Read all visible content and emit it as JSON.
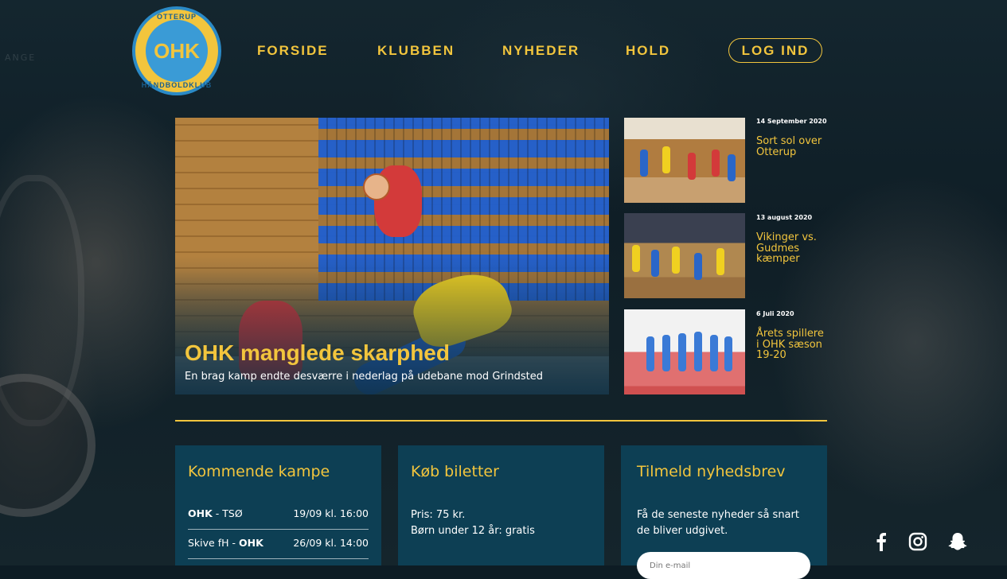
{
  "logo": {
    "ring_top": "OTTERUP",
    "center": "OHK",
    "ring_bottom": "HÅNDBOLDKLUB"
  },
  "background": {
    "banner_fragment": "ANGE"
  },
  "nav": {
    "items": [
      {
        "label": "FORSIDE"
      },
      {
        "label": "KLUBBEN"
      },
      {
        "label": "NYHEDER"
      },
      {
        "label": "HOLD"
      }
    ],
    "login_label": "LOG IND"
  },
  "hero": {
    "title": "OHK manglede skarphed",
    "subtitle": "En brag kamp endte desværre i nederlag på udebane mod Grindsted"
  },
  "news": [
    {
      "date": "14 September 2020",
      "title": "Sort sol over Otterup"
    },
    {
      "date": "13 august 2020",
      "title": "Vikinger vs. Gudmes kæmper"
    },
    {
      "date": "6 Juli 2020",
      "title": "Årets spillere i OHK sæson 19-20"
    }
  ],
  "matches": {
    "title": "Kommende kampe",
    "rows": [
      {
        "home": "OHK",
        "sep": " - ",
        "away": "TSØ",
        "bold": "home",
        "date": "19/09 kl. 16:00"
      },
      {
        "home": "Skive fH",
        "sep": " - ",
        "away": "OHK",
        "bold": "away",
        "date": "26/09 kl. 14:00"
      }
    ]
  },
  "tickets": {
    "title": "Køb biletter",
    "price_line": "Pris: 75 kr.",
    "child_line": "Børn under 12 år: gratis"
  },
  "newsletter": {
    "title": "Tilmeld nyhedsbrev",
    "line1": "Få de seneste nyheder så snart",
    "line2": "de bliver udgivet.",
    "email_placeholder": "Din e-mail"
  },
  "social": [
    "facebook-icon",
    "instagram-icon",
    "snapchat-icon"
  ],
  "colors": {
    "accent": "#f2c53d",
    "card": "#0d3f54",
    "logo_blue": "#2b8ac6"
  }
}
